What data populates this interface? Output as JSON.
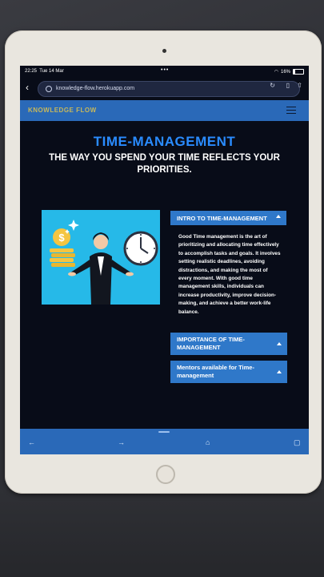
{
  "status": {
    "time": "22:25",
    "date": "Tue 14 Mar",
    "battery": "16%",
    "dots": "•••"
  },
  "browser": {
    "url": "knowledge-flow.herokuapp.com"
  },
  "site": {
    "brand": "KNOWLEDGE FLOW"
  },
  "page": {
    "title": "TIME-MANAGEMENT",
    "subtitle": "THE WAY YOU SPEND YOUR TIME REFLECTS YOUR PRIORITIES."
  },
  "accordion": {
    "intro": {
      "label": "INTRO TO TIME-MANAGEMENT",
      "body": "Good Time management is the art of prioritizing and allocating time effectively to accomplish tasks and goals. It involves setting realistic deadlines, avoiding distractions, and making the most of every moment. With good time management skills, individuals can increase productivity, improve decision-making, and achieve a better work-life balance."
    },
    "importance": {
      "label": "IMPORTANCE OF TIME-MANAGEMENT"
    },
    "mentors": {
      "label": "Mentors available for Time-management"
    }
  },
  "colors": {
    "accent": "#2a8cff",
    "nav": "#2a69b8",
    "button": "#2f78c9",
    "background": "#080c18",
    "illustration_bg": "#26b9e8",
    "brand": "#c8b85a"
  },
  "icons": {
    "back": "chevron-left-icon",
    "forward": "arrow-right-icon",
    "home": "home-icon",
    "tabs": "tabs-icon",
    "menu": "hamburger-menu-icon"
  }
}
